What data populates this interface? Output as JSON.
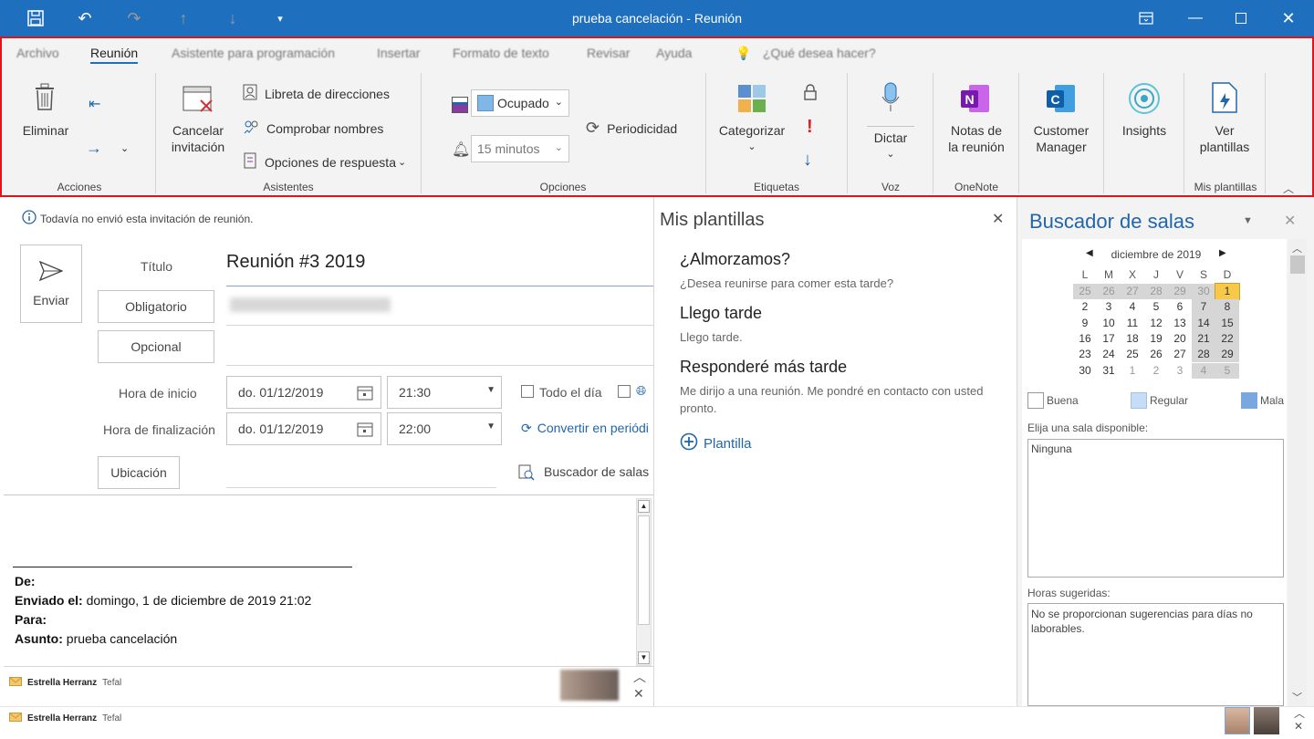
{
  "window": {
    "title": "prueba cancelación  -  Reunión"
  },
  "ribbon": {
    "tabs": [
      "Archivo",
      "Reunión",
      "Asistente para programación",
      "Insertar",
      "Formato de texto",
      "Revisar",
      "Ayuda"
    ],
    "tell_me": "¿Qué desea hacer?",
    "acciones": {
      "delete": "Eliminar",
      "group": "Acciones"
    },
    "asistentes": {
      "cancel_line1": "Cancelar",
      "cancel_line2": "invitación",
      "address_book": "Libreta de direcciones",
      "check_names": "Comprobar nombres",
      "response_options": "Opciones de respuesta",
      "group": "Asistentes"
    },
    "opciones": {
      "show_as": "Ocupado",
      "reminder": "15 minutos",
      "recurrence": "Periodicidad",
      "group": "Opciones"
    },
    "etiquetas": {
      "categorize": "Categorizar",
      "group": "Etiquetas"
    },
    "voz": {
      "dictate": "Dictar",
      "group": "Voz"
    },
    "onenote": {
      "line1": "Notas de",
      "line2": "la reunión",
      "group": "OneNote"
    },
    "customer": {
      "line1": "Customer",
      "line2": "Manager"
    },
    "insights": {
      "label": "Insights"
    },
    "plantillas": {
      "line1": "Ver",
      "line2": "plantillas",
      "group": "Mis plantillas"
    }
  },
  "form": {
    "info": "Todavía no envió esta invitación de reunión.",
    "send": "Enviar",
    "title_label": "Título",
    "title_value": "Reunión #3 2019",
    "required": "Obligatorio",
    "optional": "Opcional",
    "start_label": "Hora de inicio",
    "end_label": "Hora de finalización",
    "start_date": "do. 01/12/2019",
    "start_time": "21:30",
    "end_date": "do. 01/12/2019",
    "end_time": "22:00",
    "all_day": "Todo el día",
    "convert": "Convertir en periódi",
    "location": "Ubicación",
    "room_finder": "Buscador de salas"
  },
  "body": {
    "de": "De:",
    "enviado_label": "Enviado el:",
    "enviado_value": " domingo, 1 de diciembre de 2019 21:02",
    "para": "Para:",
    "asunto_label": "Asunto:",
    "asunto_value": " prueba cancelación"
  },
  "people_bar": {
    "name": "Estrella Herranz",
    "org": "Tefal"
  },
  "templates": {
    "title": "Mis plantillas",
    "items": [
      {
        "title": "¿Almorzamos?",
        "text": "¿Desea reunirse para comer esta tarde?"
      },
      {
        "title": "Llego tarde",
        "text": "Llego tarde."
      },
      {
        "title": "Responderé más tarde",
        "text": "Me dirijo a una reunión. Me pondré en contacto con usted pronto."
      }
    ],
    "add": "Plantilla"
  },
  "room_finder": {
    "title": "Buscador de salas",
    "month": "diciembre de 2019",
    "weekdays": [
      "L",
      "M",
      "X",
      "J",
      "V",
      "S",
      "D"
    ],
    "weeks": [
      [
        "25",
        "26",
        "27",
        "28",
        "29",
        "30",
        "1"
      ],
      [
        "2",
        "3",
        "4",
        "5",
        "6",
        "7",
        "8"
      ],
      [
        "9",
        "10",
        "11",
        "12",
        "13",
        "14",
        "15"
      ],
      [
        "16",
        "17",
        "18",
        "19",
        "20",
        "21",
        "22"
      ],
      [
        "23",
        "24",
        "25",
        "26",
        "27",
        "28",
        "29"
      ],
      [
        "30",
        "31",
        "1",
        "2",
        "3",
        "4",
        "5"
      ]
    ],
    "legend": [
      "Buena",
      "Regular",
      "Mala"
    ],
    "legend_colors": [
      "#ffffff",
      "#c7dcf7",
      "#7aa7e0"
    ],
    "choose_room": "Elija una sala disponible:",
    "room_value": "Ninguna",
    "suggested": "Horas sugeridas:",
    "suggested_value": "No se proporcionan sugerencias para días no laborables."
  }
}
